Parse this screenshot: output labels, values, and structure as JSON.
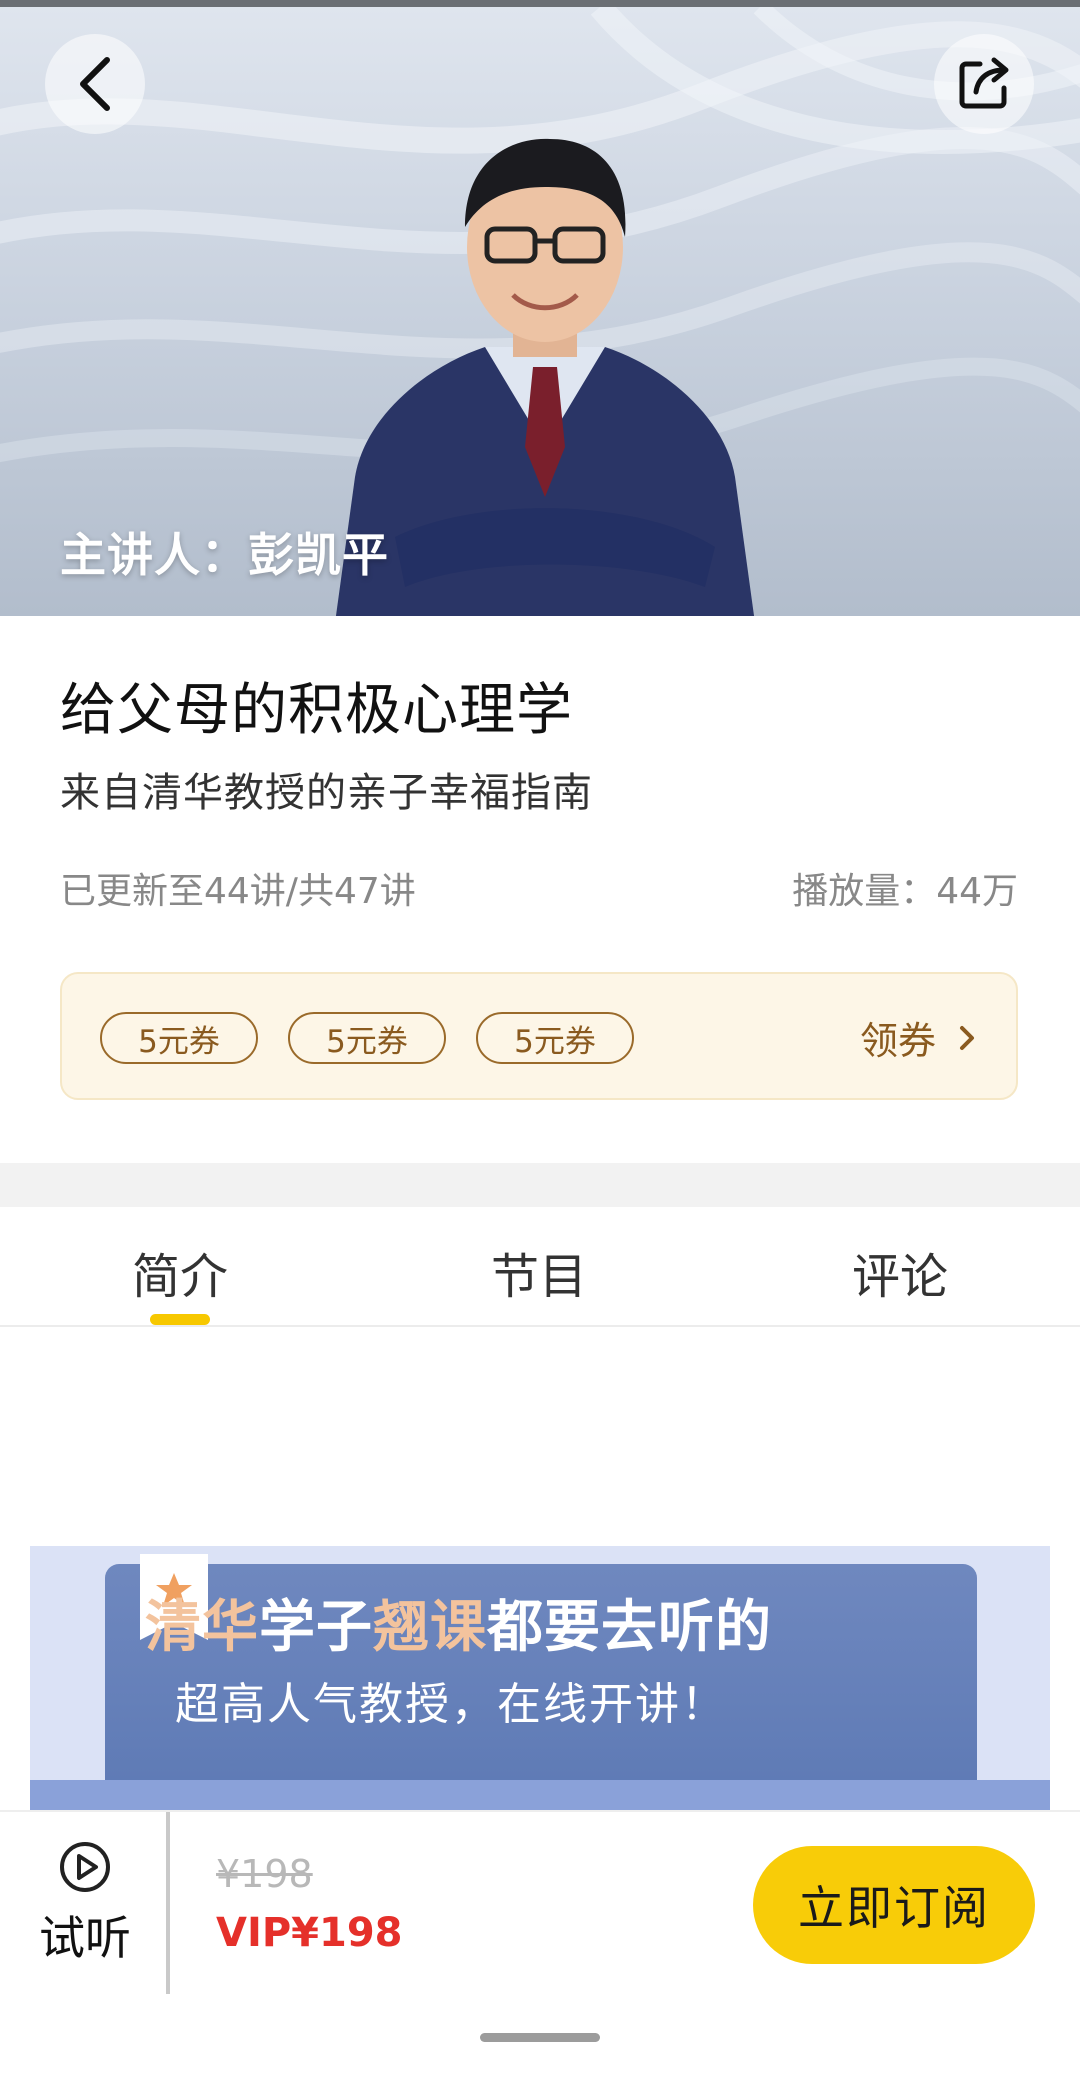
{
  "hero": {
    "speaker_caption": "主讲人：彭凯平",
    "back_icon": "chevron-left-icon",
    "share_icon": "share-icon"
  },
  "course": {
    "title": "给父母的积极心理学",
    "subtitle": "来自清华教授的亲子幸福指南",
    "progress": "已更新至44讲/共47讲",
    "plays": "播放量：44万"
  },
  "coupons": {
    "items": [
      "5元券",
      "5元券",
      "5元券"
    ],
    "claim_label": "领券"
  },
  "tabs": {
    "intro": "简介",
    "program": "节目",
    "comments": "评论",
    "active": "intro"
  },
  "banner": {
    "line1_part1": "清华",
    "line1_part2": "学子",
    "line1_part3": "翘课",
    "line1_part4": "都要去听的",
    "line2": "超高人气教授，在线开讲！"
  },
  "bottom": {
    "trial_label": "试听",
    "original_price": "¥198",
    "vip_price": "VIP¥198",
    "subscribe_label": "立即订阅"
  },
  "colors": {
    "accent_yellow": "#f8cc08",
    "price_red": "#e5302a",
    "coupon_brown": "#8a5a1f"
  }
}
